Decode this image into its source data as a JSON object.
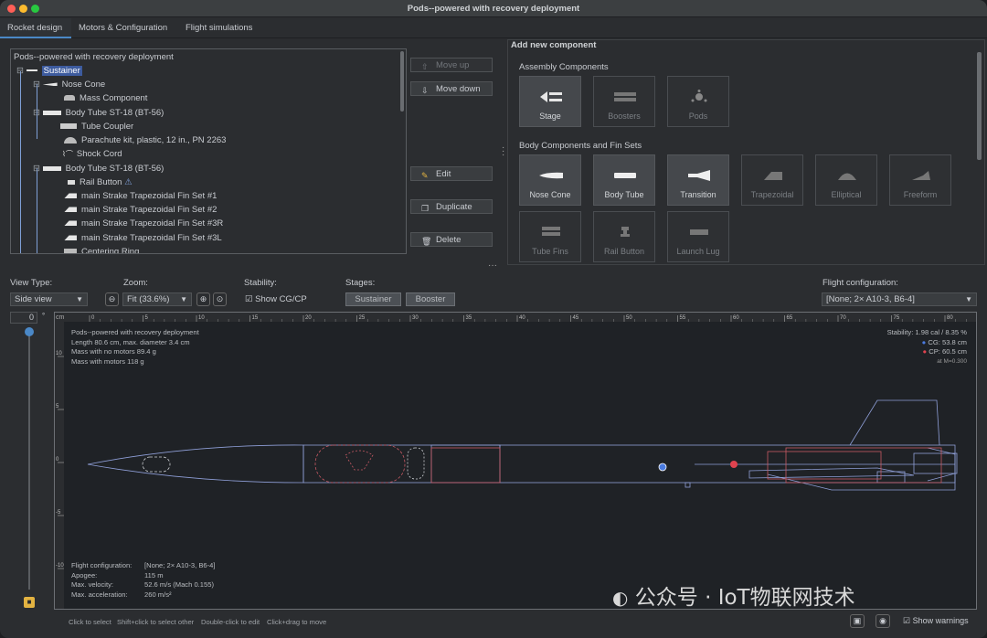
{
  "window": {
    "title": "Pods--powered with recovery deployment"
  },
  "tabs": [
    {
      "label": "Rocket design"
    },
    {
      "label": "Motors & Configuration"
    },
    {
      "label": "Flight simulations"
    }
  ],
  "tree": {
    "header": "Pods--powered with recovery deployment",
    "items": [
      {
        "label": "Sustainer"
      },
      {
        "label": "Nose Cone"
      },
      {
        "label": "Mass Component"
      },
      {
        "label": "Body Tube ST-18 (BT-56)"
      },
      {
        "label": "Tube Coupler"
      },
      {
        "label": "Parachute kit, plastic, 12 in., PN 2263"
      },
      {
        "label": "Shock Cord"
      },
      {
        "label": "Body Tube ST-18 (BT-56)"
      },
      {
        "label": "Rail Button"
      },
      {
        "label": "main Strake Trapezoidal Fin Set #1"
      },
      {
        "label": "main Strake Trapezoidal Fin Set #2"
      },
      {
        "label": "main Strake Trapezoidal Fin Set #3R"
      },
      {
        "label": "main Strake Trapezoidal Fin Set #3L"
      },
      {
        "label": "Centering Ring"
      }
    ]
  },
  "side_buttons": {
    "move_up": "Move up",
    "move_down": "Move down",
    "edit": "Edit",
    "duplicate": "Duplicate",
    "delete": "Delete"
  },
  "add_component": {
    "title": "Add new component",
    "assembly_title": "Assembly Components",
    "assembly": [
      {
        "label": "Stage"
      },
      {
        "label": "Boosters"
      },
      {
        "label": "Pods"
      }
    ],
    "body_title": "Body Components and Fin Sets",
    "body": [
      {
        "label": "Nose Cone"
      },
      {
        "label": "Body Tube"
      },
      {
        "label": "Transition"
      },
      {
        "label": "Trapezoidal"
      },
      {
        "label": "Elliptical"
      },
      {
        "label": "Freeform"
      },
      {
        "label": "Tube Fins"
      },
      {
        "label": "Rail Button"
      },
      {
        "label": "Launch Lug"
      }
    ]
  },
  "view": {
    "view_type_label": "View Type:",
    "view_type": "Side view",
    "zoom_label": "Zoom:",
    "zoom": "Fit (33.6%)",
    "stability_label": "Stability:",
    "show_cgcp": "Show CG/CP",
    "stages_label": "Stages:",
    "stage_buttons": [
      "Sustainer",
      "Booster"
    ],
    "flight_config_label": "Flight configuration:",
    "flight_config": "[None; 2× A10-3, B6-4]",
    "rotation": "0",
    "rotation_unit": "°"
  },
  "ruler": {
    "unit": "cm",
    "top_ticks": [
      "0",
      "5",
      "10",
      "15",
      "20",
      "25",
      "30",
      "35",
      "40",
      "45",
      "50",
      "55",
      "60",
      "65",
      "70",
      "75",
      "80"
    ],
    "left_ticks": [
      "10",
      "5",
      "0",
      "-5",
      "-10"
    ]
  },
  "rocket_info": {
    "name": "Pods--powered with recovery deployment",
    "length": "Length 80.6 cm, max. diameter 3.4 cm",
    "mass_no_motors": "Mass with no motors 89.4 g",
    "mass_with_motors": "Mass with motors 118 g"
  },
  "stability_info": {
    "stability": "Stability: 1.98 cal / 8.35 %",
    "cg": "CG: 53.8 cm",
    "cp": "CP: 60.5 cm",
    "mach": "at M=0.300"
  },
  "flight_info": {
    "config_label": "Flight configuration:",
    "config_value": "[None; 2× A10-3, B6-4]",
    "apogee_label": "Apogee:",
    "apogee_value": "115 m",
    "velocity_label": "Max. velocity:",
    "velocity_value": "52.6 m/s  (Mach 0.155)",
    "accel_label": "Max. acceleration:",
    "accel_value": "260 m/s²"
  },
  "status": {
    "hints": [
      "Click to select",
      "Shift+click to select other",
      "Double-click to edit",
      "Click+drag to move"
    ],
    "show_warnings": "Show warnings"
  },
  "watermark": "公众号 · IoT物联网技术",
  "colors": {
    "accent": "#4a88c7",
    "cg": "#4a7be0",
    "cp": "#e0434f",
    "outline": "#8f9fd8",
    "inner": "#c85a64"
  }
}
